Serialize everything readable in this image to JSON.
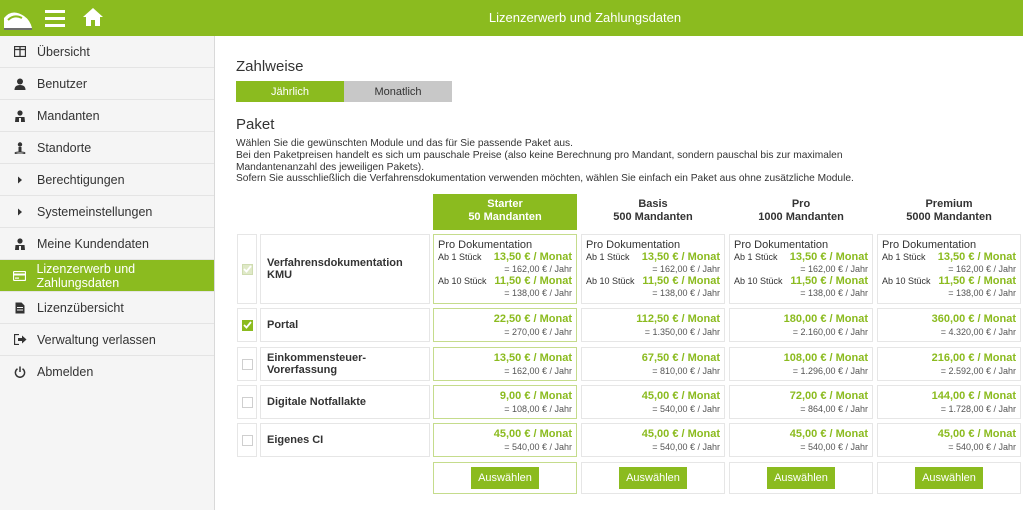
{
  "topbar": {
    "title": "Lizenzerwerb und Zahlungsdaten"
  },
  "sidebar": {
    "items": [
      {
        "label": "Übersicht",
        "icon": "overview-icon"
      },
      {
        "label": "Benutzer",
        "icon": "user-icon"
      },
      {
        "label": "Mandanten",
        "icon": "clients-icon"
      },
      {
        "label": "Standorte",
        "icon": "location-icon"
      },
      {
        "label": "Berechtigungen",
        "icon": "chevron-right-icon"
      },
      {
        "label": "Systemeinstellungen",
        "icon": "chevron-right-icon"
      },
      {
        "label": "Meine Kundendaten",
        "icon": "customer-icon"
      },
      {
        "label": "Lizenzerwerb und Zahlungsdaten",
        "icon": "credit-card-icon",
        "active": true
      },
      {
        "label": "Lizenzübersicht",
        "icon": "document-icon"
      },
      {
        "label": "Verwaltung verlassen",
        "icon": "exit-icon"
      },
      {
        "label": "Abmelden",
        "icon": "power-icon"
      }
    ]
  },
  "zahlweise": {
    "heading": "Zahlweise",
    "options": [
      "Jährlich",
      "Monatlich"
    ],
    "selected": "Jährlich"
  },
  "paket": {
    "heading": "Paket",
    "description": [
      "Wählen Sie die gewünschten Module und das für Sie passende Paket aus.",
      "Bei den Paketpreisen handelt es sich um pauschale Preise (also keine Berechnung pro Mandant, sondern pauschal bis zur maximalen",
      "Mandantenanzahl des jeweiligen Pakets).",
      "Sofern Sie ausschließlich die Verfahrensdokumentation verwenden möchten, wählen Sie einfach ein Paket aus ohne zusätzliche Module."
    ]
  },
  "packages": [
    {
      "name": "Starter",
      "clients": "50 Mandanten",
      "selected": true
    },
    {
      "name": "Basis",
      "clients": "500 Mandanten",
      "selected": false
    },
    {
      "name": "Pro",
      "clients": "1000 Mandanten",
      "selected": false
    },
    {
      "name": "Premium",
      "clients": "5000 Mandanten",
      "selected": false
    }
  ],
  "doc_module": {
    "label": "Verfahrensdokumentation KMU",
    "checked": true,
    "disabled": true,
    "price_title": "Pro Dokumentation",
    "tier1_label": "Ab 1 Stück",
    "tier1_price": "13,50 € / Monat",
    "tier1_year": "= 162,00 € / Jahr",
    "tier2_label": "Ab 10 Stück",
    "tier2_price": "11,50 € / Monat",
    "tier2_year": "= 138,00 € / Jahr"
  },
  "modules": [
    {
      "label": "Portal",
      "checked": true,
      "prices": [
        {
          "m": "22,50 € / Monat",
          "y": "= 270,00 € / Jahr"
        },
        {
          "m": "112,50 € / Monat",
          "y": "= 1.350,00 € / Jahr"
        },
        {
          "m": "180,00 € / Monat",
          "y": "= 2.160,00 € / Jahr"
        },
        {
          "m": "360,00 € / Monat",
          "y": "= 4.320,00 € / Jahr"
        }
      ]
    },
    {
      "label": "Einkommensteuer-Vorerfassung",
      "checked": false,
      "prices": [
        {
          "m": "13,50 € / Monat",
          "y": "= 162,00 € / Jahr"
        },
        {
          "m": "67,50 € / Monat",
          "y": "= 810,00 € / Jahr"
        },
        {
          "m": "108,00 € / Monat",
          "y": "= 1.296,00 € / Jahr"
        },
        {
          "m": "216,00 € / Monat",
          "y": "= 2.592,00 € / Jahr"
        }
      ]
    },
    {
      "label": "Digitale Notfallakte",
      "checked": false,
      "prices": [
        {
          "m": "9,00 € / Monat",
          "y": "= 108,00 € / Jahr"
        },
        {
          "m": "45,00 € / Monat",
          "y": "= 540,00 € / Jahr"
        },
        {
          "m": "72,00 € / Monat",
          "y": "= 864,00 € / Jahr"
        },
        {
          "m": "144,00 € / Monat",
          "y": "= 1.728,00 € / Jahr"
        }
      ]
    },
    {
      "label": "Eigenes CI",
      "checked": false,
      "prices": [
        {
          "m": "45,00 € / Monat",
          "y": "= 540,00 € / Jahr"
        },
        {
          "m": "45,00 € / Monat",
          "y": "= 540,00 € / Jahr"
        },
        {
          "m": "45,00 € / Monat",
          "y": "= 540,00 € / Jahr"
        },
        {
          "m": "45,00 € / Monat",
          "y": "= 540,00 € / Jahr"
        }
      ]
    }
  ],
  "select_button_label": "Auswählen",
  "colors": {
    "accent": "#8bbb1f",
    "toggle_off": "#c8c8c8"
  }
}
